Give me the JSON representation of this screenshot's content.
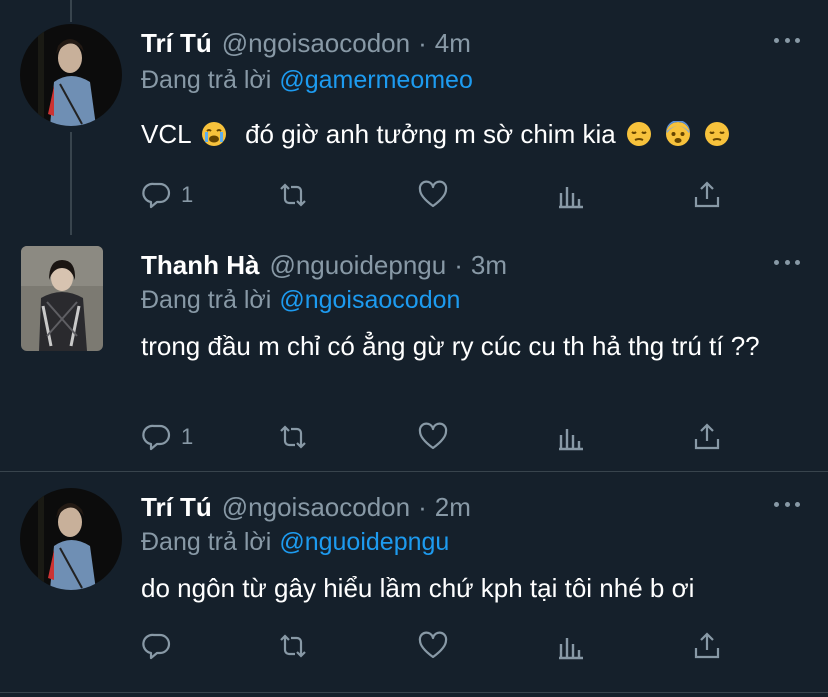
{
  "tweets": [
    {
      "name": "Trí Tú",
      "handle": "@ngoisaocodon",
      "time": "4m",
      "reply_prefix": "Đang trả lời",
      "reply_to": "@gamermeomeo",
      "text_before_emoji": "VCL",
      "text_after_emoji": "đó giờ anh tưởng m sờ chim kia",
      "emojis": [
        "loudly-crying-face",
        "pensive-face",
        "fearful-face",
        "pensive-face"
      ],
      "reply_count": "1"
    },
    {
      "name": "Thanh Hà",
      "handle": "@nguoidepngu",
      "time": "3m",
      "reply_prefix": "Đang trả lời",
      "reply_to": "@ngoisaocodon",
      "text": "trong đầu m chỉ có ẳng gừ ry cúc cu th hả thg trú tí ??",
      "reply_count": "1"
    },
    {
      "name": "Trí Tú",
      "handle": "@ngoisaocodon",
      "time": "2m",
      "reply_prefix": "Đang trả lời",
      "reply_to": "@nguoidepngu",
      "text": "do ngôn từ gây hiểu lầm chứ kph tại tôi nhé b ơi",
      "reply_count": ""
    }
  ],
  "separator": "·",
  "colors": {
    "background": "#15202b",
    "muted": "#8899a6",
    "accent": "#1d9bf0",
    "divider": "#38444d"
  },
  "icons": [
    "reply-icon",
    "retweet-icon",
    "like-icon",
    "analytics-icon",
    "share-icon",
    "more-icon"
  ]
}
